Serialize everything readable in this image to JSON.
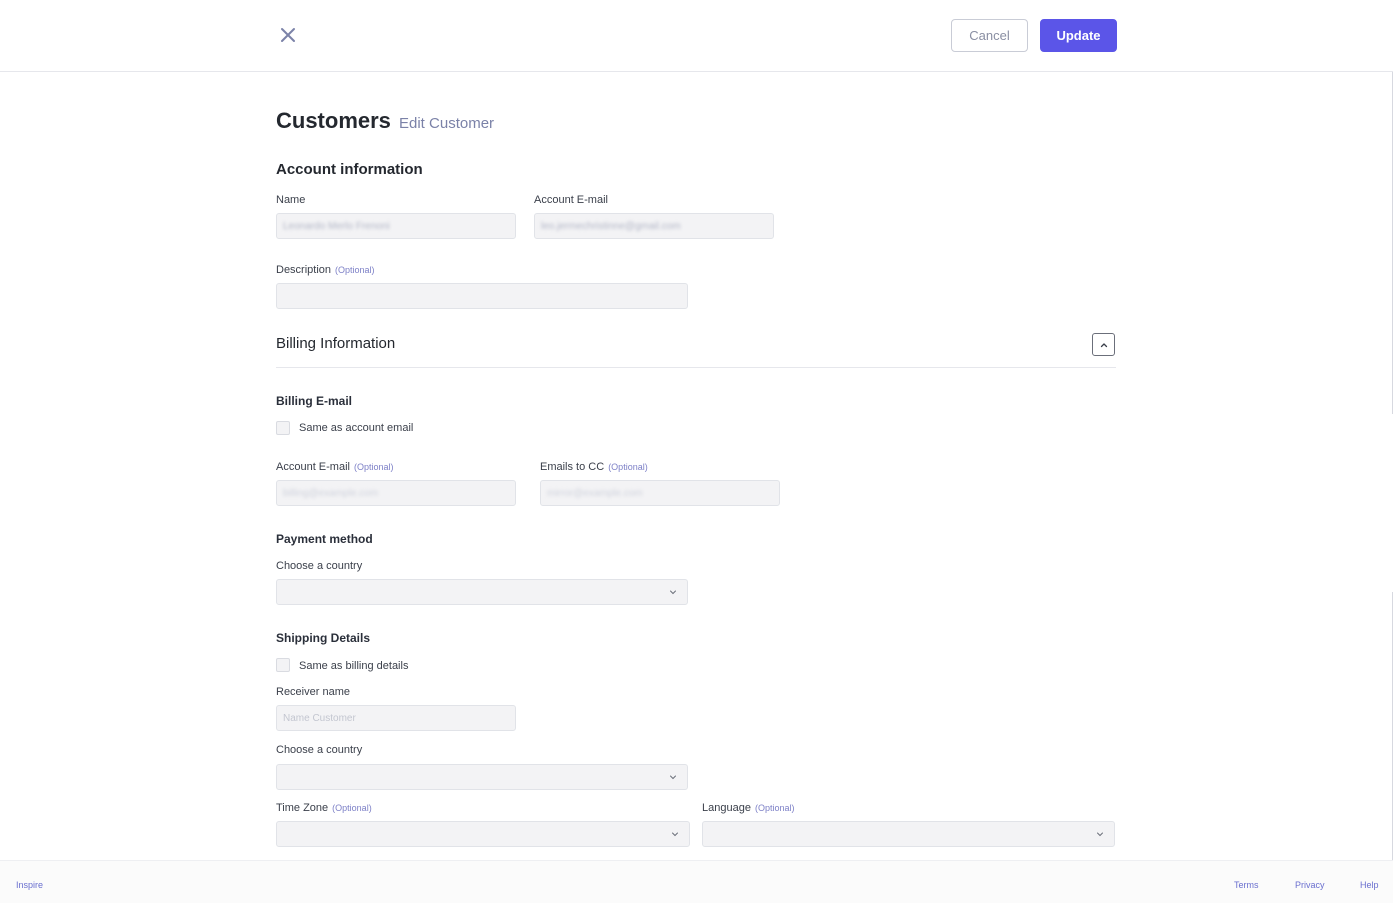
{
  "header": {
    "cancel_label": "Cancel",
    "update_label": "Update"
  },
  "page": {
    "title": "Customers",
    "subtitle": "Edit Customer"
  },
  "account": {
    "section_title": "Account information",
    "name_label": "Name",
    "name_value": "Leonardo Merlo Frenoni",
    "email_label": "Account E-mail",
    "email_value": "leo.jermechristinne@gmail.com",
    "description_label": "Description",
    "description_optional": "(Optional)",
    "description_value": ""
  },
  "billing": {
    "section_title": "Billing Information",
    "billing_email_title": "Billing E-mail",
    "same_as_account_label": "Same as account email",
    "account_email_label": "Account E-mail",
    "account_email_optional": "(Optional)",
    "account_email_placeholder": "billing@example.com",
    "cc_label": "Emails to CC",
    "cc_optional": "(Optional)",
    "cc_placeholder": "mirror@example.com",
    "payment_title": "Payment method",
    "country_label": "Choose a country",
    "country_value": ""
  },
  "shipping": {
    "section_title": "Shipping Details",
    "same_as_billing_label": "Same as billing details",
    "receiver_label": "Receiver name",
    "receiver_placeholder": "Name Customer",
    "country_label": "Choose a country",
    "country_value": "",
    "timezone_label": "Time Zone",
    "timezone_optional": "(Optional)",
    "timezone_value": "",
    "language_label": "Language",
    "language_optional": "(Optional)",
    "language_value": ""
  },
  "footer": {
    "brand": "Inspire",
    "terms": "Terms",
    "privacy": "Privacy",
    "help": "Help"
  },
  "icons": {
    "close": "close-icon",
    "collapse": "chevron-up-icon",
    "dropdown": "chevron-down-icon"
  },
  "colors": {
    "accent": "#5b55e8",
    "optional_text": "#7d80c7",
    "subtitle_text": "#7b82a8"
  }
}
